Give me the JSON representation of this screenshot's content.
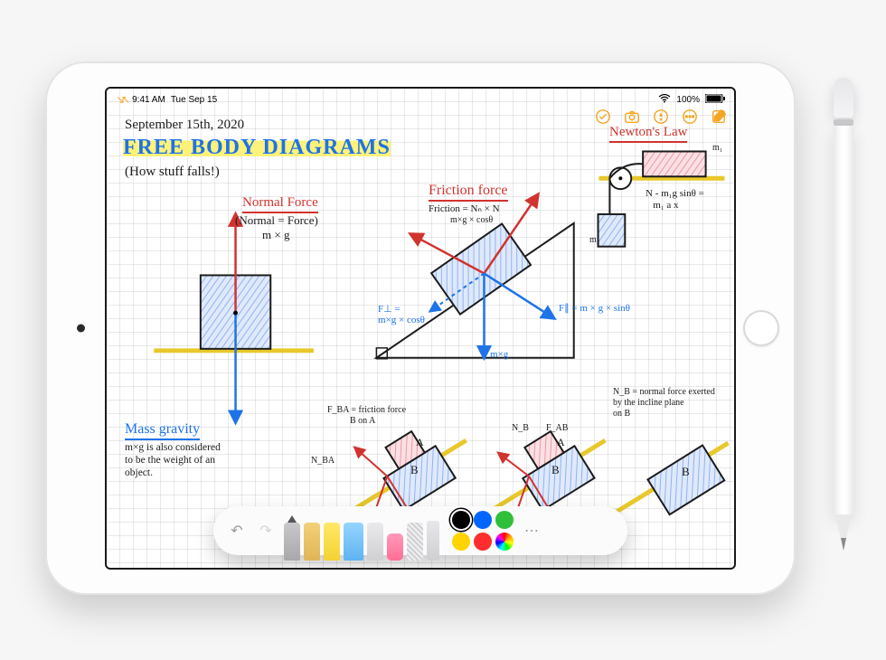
{
  "status": {
    "time": "9:41 AM",
    "date": "Tue Sep 15",
    "battery": "100%"
  },
  "note": {
    "date": "September 15th, 2020",
    "title": "FREE BODY DIAGRAMS",
    "subtitle": "(How stuff falls!)",
    "sections": {
      "normal": {
        "heading": "Normal Force",
        "line1": "(Normal = Force)",
        "line2": "m × g"
      },
      "massg": {
        "heading": "Mass gravity",
        "body": "m×g is also considered\nto be the weight of an\nobject."
      },
      "friction": {
        "heading": "Friction force",
        "eq1": "Friction = Nₙ × N",
        "eq2": "m×g × cosθ",
        "Fperp": "F⊥ =\nm×g × cosθ",
        "Fpar": "F∥ = m × g × sinθ",
        "mg": "m×g"
      },
      "newton": {
        "heading": "Newton's Law",
        "eq": "N - m₁g sinθ =\n   m₁ a x",
        "m1": "m₁",
        "m2": "m₂"
      },
      "stack": {
        "fba": "F_BA = friction force\n          B on A",
        "nba": "N_BA",
        "a": "A",
        "b": "B",
        "nb": "N_B",
        "fab": "F_AB",
        "nbdef": "N_B = normal force exerted\nby the incline plane\non B"
      }
    }
  },
  "palette": {
    "colors": [
      "#000000",
      "#0066ff",
      "#2fbf3a",
      "#ffd400",
      "#ff2d2d"
    ],
    "selected": 0
  }
}
